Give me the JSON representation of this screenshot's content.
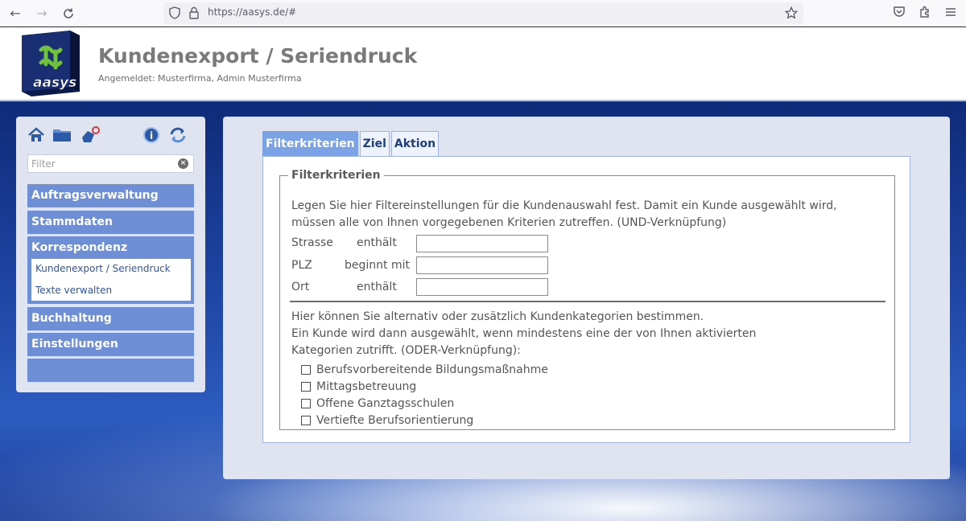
{
  "browser": {
    "url": "https://aasys.de/#"
  },
  "header": {
    "title": "Kundenexport / Seriendruck",
    "subtitle": "Angemeldet: Musterfirma, Admin Musterfirma",
    "logo_text": "aasys"
  },
  "sidebar": {
    "icons": [
      "home-icon",
      "folder-icon",
      "logout-icon",
      "info-icon",
      "refresh-icon"
    ],
    "filter_placeholder": "Filter",
    "menu": [
      {
        "label": "Auftragsverwaltung"
      },
      {
        "label": "Stammdaten"
      },
      {
        "label": "Korrespondenz",
        "children": [
          {
            "label": "Kundenexport / Seriendruck"
          },
          {
            "label": "Texte verwalten"
          }
        ]
      },
      {
        "label": "Buchhaltung"
      },
      {
        "label": "Einstellungen"
      }
    ]
  },
  "tabs": [
    {
      "label": "Filterkriterien",
      "active": true
    },
    {
      "label": "Ziel",
      "active": false
    },
    {
      "label": "Aktion",
      "active": false
    }
  ],
  "filter": {
    "legend": "Filterkriterien",
    "description_line1": "Legen Sie hier Filtereinstellungen für die Kundenauswahl fest. Damit ein Kunde ausgewählt wird,",
    "description_line2": "müssen alle von Ihnen vorgegebenen Kriterien zutreffen. (UND-Verknüpfung)",
    "fields": [
      {
        "label": "Strasse",
        "operator": "enthält",
        "value": ""
      },
      {
        "label": "PLZ",
        "operator": "beginnt mit",
        "value": ""
      },
      {
        "label": "Ort",
        "operator": "enthält",
        "value": ""
      }
    ],
    "category_text_line1": "Hier können Sie alternativ oder zusätzlich Kundenkategorien bestimmen.",
    "category_text_line2": "Ein Kunde wird dann ausgewählt, wenn mindestens eine der von Ihnen aktivierten",
    "category_text_line3": "Kategorien zutrifft. (ODER-Verknüpfung):",
    "categories": [
      {
        "label": "Berufsvorbereitende Bildungsmaßnahme",
        "checked": false
      },
      {
        "label": "Mittagsbetreuung",
        "checked": false
      },
      {
        "label": "Offene Ganztagsschulen",
        "checked": false
      },
      {
        "label": "Vertiefte Berufsorientierung",
        "checked": false
      }
    ]
  },
  "colors": {
    "menu_bg": "#6e8ed6",
    "tab_active": "#7ca2e6",
    "panel_bg": "#dfe4f0",
    "background_blue": "#1e46a4"
  }
}
